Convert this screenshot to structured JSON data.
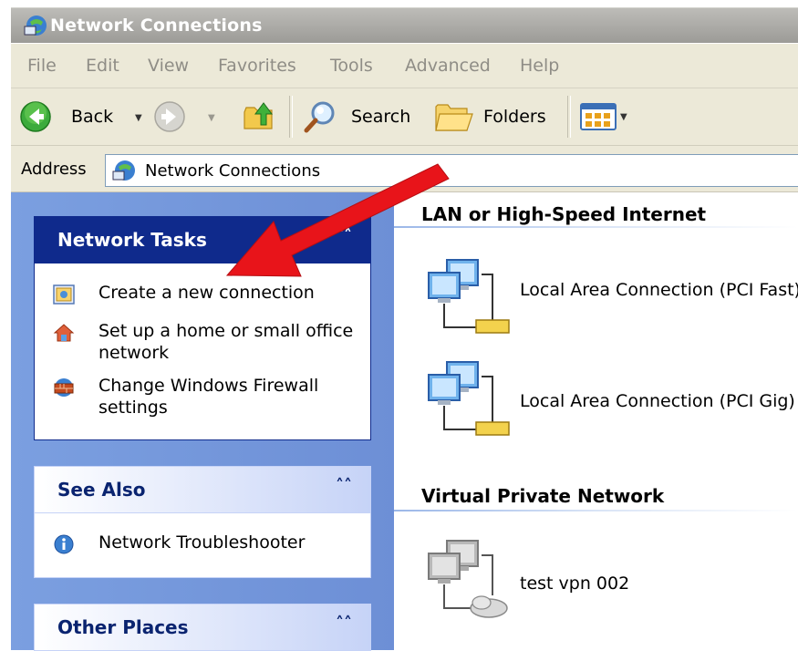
{
  "window": {
    "title": "Network Connections"
  },
  "menu": [
    "File",
    "Edit",
    "View",
    "Favorites",
    "Tools",
    "Advanced",
    "Help"
  ],
  "toolbar": {
    "back_label": "Back",
    "search_label": "Search",
    "folders_label": "Folders"
  },
  "address": {
    "label": "Address",
    "value": "Network Connections"
  },
  "sidebar": {
    "network_tasks": {
      "title": "Network Tasks",
      "items": [
        {
          "label": "Create a new connection",
          "icon": "new-connection-icon"
        },
        {
          "label": "Set up a home or small office network",
          "icon": "home-network-icon"
        },
        {
          "label": "Change Windows Firewall settings",
          "icon": "firewall-icon"
        }
      ]
    },
    "see_also": {
      "title": "See Also",
      "items": [
        {
          "label": "Network Troubleshooter",
          "icon": "info-icon"
        }
      ]
    },
    "other_places": {
      "title": "Other Places"
    }
  },
  "groups": [
    {
      "title": "LAN or High-Speed Internet",
      "connections": [
        {
          "label": "Local Area Connection (PCI Fast)",
          "icon": "lan-connection-icon"
        },
        {
          "label": "Local Area Connection (PCI Gig)",
          "icon": "lan-connection-icon"
        }
      ]
    },
    {
      "title": "Virtual Private Network",
      "connections": [
        {
          "label": "test vpn 002",
          "icon": "vpn-connection-icon"
        }
      ]
    }
  ],
  "annotation": {
    "arrow_color": "#e8141a"
  },
  "colors": {
    "sidebar_bg": "#7b9fe0",
    "panel_header_dark": "#0f2a8c",
    "panel_header_light": "#d6dff5",
    "toolbar_bg": "#ece9d8"
  }
}
